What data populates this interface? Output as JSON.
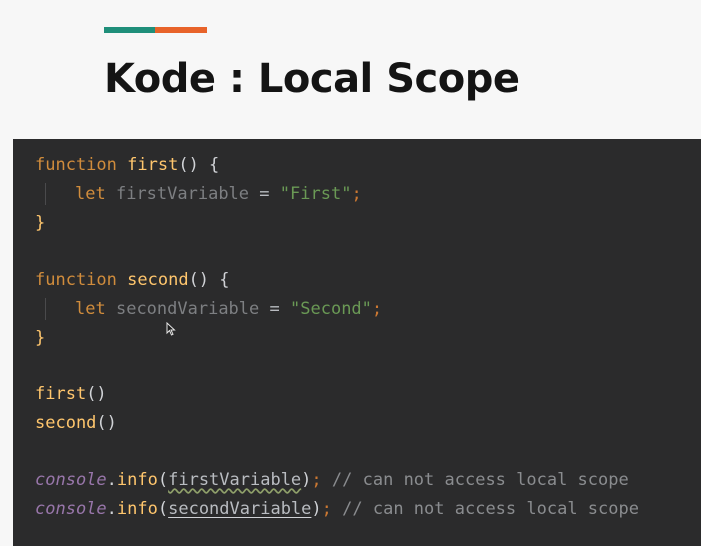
{
  "accent": {
    "color_left": "#1f8f7a",
    "color_right": "#e8632a"
  },
  "title": "Kode : Local Scope",
  "code": {
    "line1": {
      "kw": "function",
      "name": "first",
      "rest": "() {"
    },
    "line2": {
      "kw": "let",
      "var": "firstVariable",
      "eq": "=",
      "str": "\"First\"",
      "semi": ";"
    },
    "line3": {
      "close": "}"
    },
    "line4": {
      "kw": "function",
      "name": "second",
      "rest": "() {"
    },
    "line5": {
      "kw": "let",
      "var": "secondVariable",
      "eq": "=",
      "str": "\"Second\"",
      "semi": ";"
    },
    "line6": {
      "close": "}"
    },
    "line7": {
      "call": "first",
      "parens": "()"
    },
    "line8": {
      "call": "second",
      "parens": "()"
    },
    "line9": {
      "obj": "console",
      "dot": ".",
      "method": "info",
      "open": "(",
      "arg": "firstVariable",
      "close": ")",
      "semi": ";",
      "comment": "// can not access local scope"
    },
    "line10": {
      "obj": "console",
      "dot": ".",
      "method": "info",
      "open": "(",
      "arg": "secondVariable",
      "close": ")",
      "semi": ";",
      "comment": "// can not access local scope"
    }
  },
  "icons": {
    "cursor": "mouse-pointer-icon"
  }
}
